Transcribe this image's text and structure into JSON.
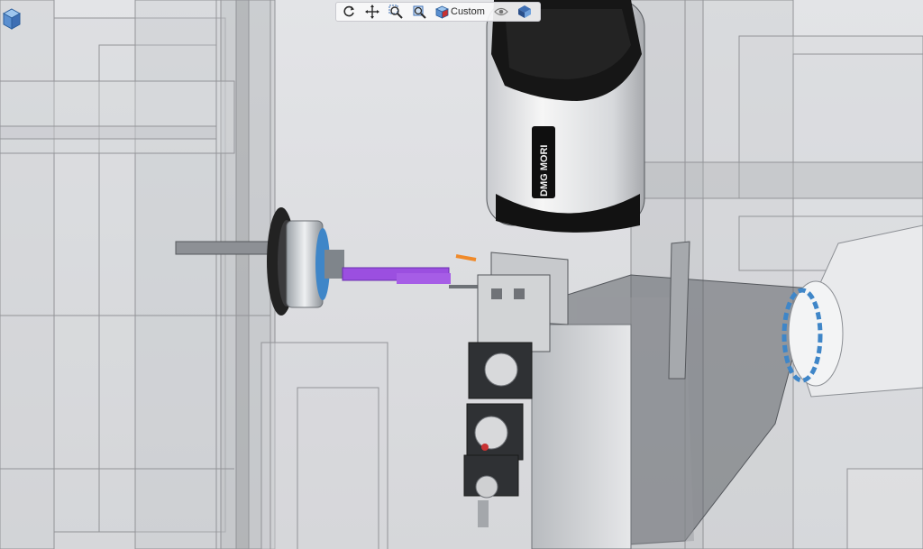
{
  "toolbar": {
    "view_mode_label": "Custom",
    "buttons": [
      {
        "name": "rotate-view-button",
        "icon": "rotate-icon"
      },
      {
        "name": "pan-view-button",
        "icon": "pan-icon"
      },
      {
        "name": "zoom-window-button",
        "icon": "zoom-window-icon"
      },
      {
        "name": "zoom-fit-button",
        "icon": "zoom-fit-icon"
      },
      {
        "name": "view-mode-button",
        "icon": "cube-view-icon"
      },
      {
        "name": "visibility-toggle-button",
        "icon": "eye-icon"
      },
      {
        "name": "display-style-button",
        "icon": "display-style-icon"
      }
    ]
  },
  "scene": {
    "spindle_brand": "DMG MORI",
    "colors": {
      "background": "#dcdde0",
      "workpiece": "#9b4fe0",
      "tool_tip": "#f08a2a",
      "fixture_blue": "#3f86c8",
      "spindle_dark": "#1a1a1a",
      "turret_grey": "#8a8d92"
    }
  }
}
